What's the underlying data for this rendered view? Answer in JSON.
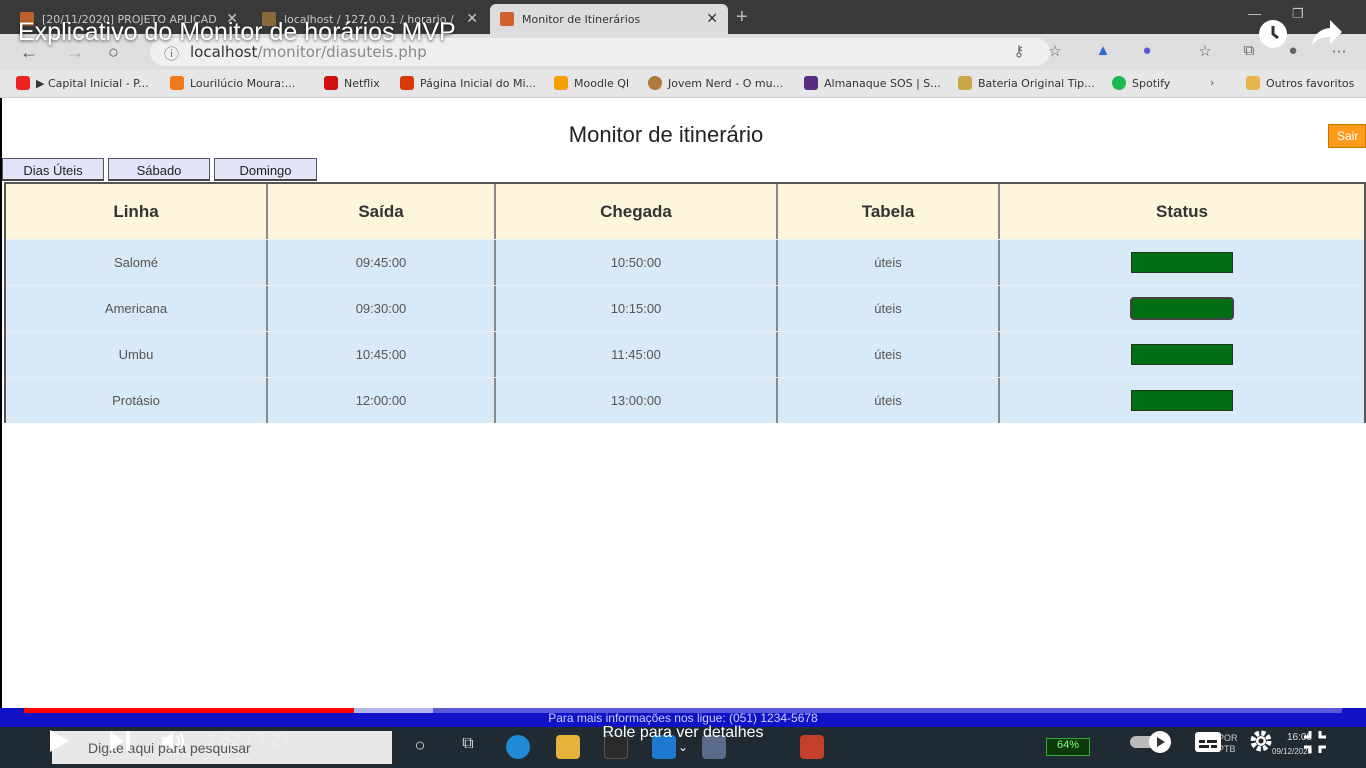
{
  "video": {
    "title": "Explicativo do Monitor de horários MVP",
    "time": "1:52 / 7:27",
    "progress_played": 0.25,
    "progress_buffered": 0.31,
    "scroll_hint": "Role para ver detalhes"
  },
  "browser": {
    "tabs": [
      {
        "label": "[20/11/2020] PROJETO APLICAD..."
      },
      {
        "label": "localhost / 127.0.0.1 / horario / ..."
      },
      {
        "label": "Monitor de Itinerários"
      }
    ],
    "url_host": "localhost",
    "url_path": "/monitor/diasuteis.php",
    "bookmarks": [
      {
        "label": "▶ Capital Inicial - P...",
        "color": "#e22"
      },
      {
        "label": "Lourilúcio Moura:...",
        "color": "#f07a1a"
      },
      {
        "label": "Netflix",
        "color": "#d01010"
      },
      {
        "label": "Página Inicial do Mi...",
        "color": "#d83b01"
      },
      {
        "label": "Moodle QI",
        "color": "#f3a000"
      },
      {
        "label": "Jovem Nerd - O mu...",
        "color": "#b07a3a"
      },
      {
        "label": "Almanaque SOS | S...",
        "color": "#5a2d82"
      },
      {
        "label": "Bateria Original Tip...",
        "color": "#c9a84a"
      },
      {
        "label": "Spotify",
        "color": "#1db954"
      },
      {
        "label": "Outros favoritos",
        "color": "#e8b64c"
      }
    ]
  },
  "page": {
    "title": "Monitor de itinerário",
    "exit_label": "Sair",
    "day_tabs": [
      "Dias Úteis",
      "Sábado",
      "Domingo"
    ],
    "table": {
      "headers": [
        "Linha",
        "Saída",
        "Chegada",
        "Tabela",
        "Status"
      ],
      "rows": [
        {
          "linha": "Salomé",
          "saida": "09:45:00",
          "chegada": "10:50:00",
          "tabela": "úteis"
        },
        {
          "linha": "Americana",
          "saida": "09:30:00",
          "chegada": "10:15:00",
          "tabela": "úteis"
        },
        {
          "linha": "Umbu",
          "saida": "10:45:00",
          "chegada": "11:45:00",
          "tabela": "úteis"
        },
        {
          "linha": "Protásio",
          "saida": "12:00:00",
          "chegada": "13:00:00",
          "tabela": "úteis"
        }
      ],
      "status_color": "#006e12"
    },
    "footer_text": "Para mais informações nos ligue: (051) 1234-5678"
  },
  "taskbar": {
    "search_placeholder": "Digite aqui para pesquisar",
    "clock_lang": "POR PTB",
    "clock_time": "16:08",
    "clock_date": "09/12/2020"
  }
}
